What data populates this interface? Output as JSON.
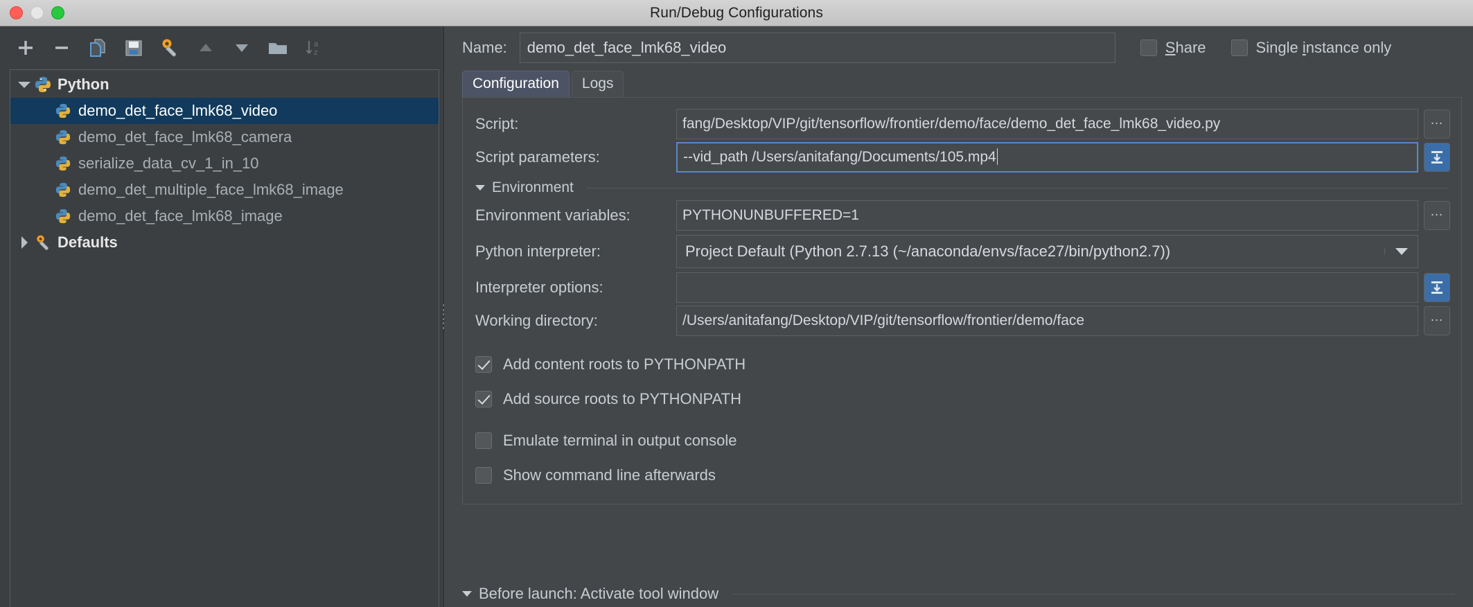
{
  "window": {
    "title": "Run/Debug Configurations",
    "traffic": {
      "close": "close-button",
      "minimize": "minimize-button",
      "zoom": "zoom-button"
    }
  },
  "toolbar": {
    "buttons": [
      {
        "name": "add-configuration-button",
        "icon": "plus-icon"
      },
      {
        "name": "remove-configuration-button",
        "icon": "minus-icon"
      },
      {
        "name": "copy-configuration-button",
        "icon": "copy-icon"
      },
      {
        "name": "save-configuration-button",
        "icon": "save-icon"
      },
      {
        "name": "edit-defaults-button",
        "icon": "wrench-icon"
      },
      {
        "name": "move-up-button",
        "icon": "triangle-up-icon"
      },
      {
        "name": "move-down-button",
        "icon": "triangle-down-icon"
      },
      {
        "name": "create-folder-button",
        "icon": "folder-icon"
      },
      {
        "name": "sort-configurations-button",
        "icon": "sort-az-icon"
      }
    ]
  },
  "tree": {
    "groups": [
      {
        "label": "Python",
        "expanded": true,
        "icon": "python-icon",
        "children": [
          {
            "label": "demo_det_face_lmk68_video",
            "selected": true,
            "icon": "python-icon"
          },
          {
            "label": "demo_det_face_lmk68_camera",
            "selected": false,
            "icon": "python-icon"
          },
          {
            "label": "serialize_data_cv_1_in_10",
            "selected": false,
            "icon": "python-icon"
          },
          {
            "label": "demo_det_multiple_face_lmk68_image",
            "selected": false,
            "icon": "python-icon"
          },
          {
            "label": "demo_det_face_lmk68_image",
            "selected": false,
            "icon": "python-icon"
          }
        ]
      },
      {
        "label": "Defaults",
        "expanded": false,
        "icon": "wrench-icon",
        "children": []
      }
    ]
  },
  "header": {
    "name_label": "Name:",
    "name_value": "demo_det_face_lmk68_video",
    "share": {
      "label": "Share",
      "mnemonic": "S",
      "checked": false
    },
    "single_instance": {
      "label": "Single instance only",
      "mnemonic": "i",
      "checked": false
    }
  },
  "tabs": [
    {
      "label": "Configuration",
      "active": true
    },
    {
      "label": "Logs",
      "active": false
    }
  ],
  "form": {
    "script": {
      "label": "Script:",
      "value": "fang/Desktop/VIP/git/tensorflow/frontier/demo/face/demo_det_face_lmk68_video.py",
      "browse": "…"
    },
    "script_parameters": {
      "label": "Script parameters:",
      "value": "--vid_path  /Users/anitafang/Documents/105.mp4",
      "focused": true,
      "expand": "expand-icon"
    },
    "environment_section": {
      "label": "Environment",
      "expanded": true
    },
    "environment_variables": {
      "label": "Environment variables:",
      "value": "PYTHONUNBUFFERED=1",
      "browse": "…"
    },
    "python_interpreter": {
      "label": "Python interpreter:",
      "value": "Project Default (Python 2.7.13 (~/anaconda/envs/face27/bin/python2.7))"
    },
    "interpreter_options": {
      "label": "Interpreter options:",
      "value": "",
      "expand": "expand-icon"
    },
    "working_directory": {
      "label": "Working directory:",
      "value": "/Users/anitafang/Desktop/VIP/git/tensorflow/frontier/demo/face",
      "browse": "…"
    },
    "checkboxes": [
      {
        "label": "Add content roots to PYTHONPATH",
        "checked": true
      },
      {
        "label": "Add source roots to PYTHONPATH",
        "checked": true
      },
      {
        "label": "Emulate terminal in output console",
        "checked": false
      },
      {
        "label": "Show command line afterwards",
        "checked": false
      }
    ]
  },
  "before_launch": {
    "label": "Before launch: Activate tool window",
    "expanded": true
  },
  "colors": {
    "window_bg": "#43474a",
    "panel_bg": "#3c3f41",
    "selection": "#113a5c",
    "accent_tab": "#4b5364",
    "focus_border": "#5b87c7",
    "text": "#c8cdd1"
  }
}
